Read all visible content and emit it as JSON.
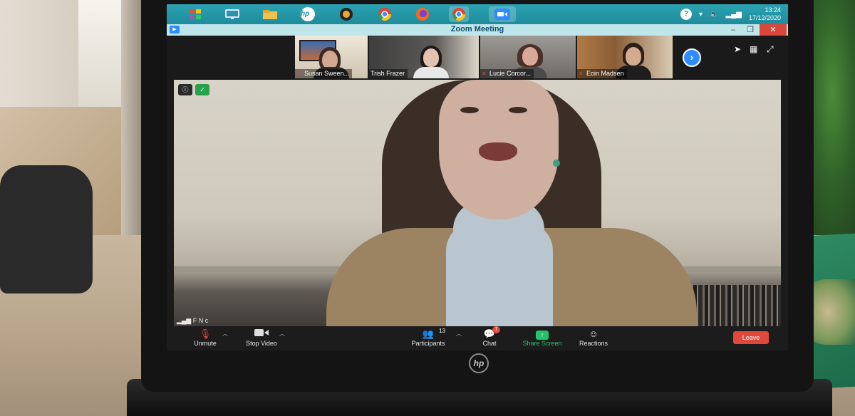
{
  "taskbar": {
    "icons": [
      "app-grid-icon",
      "display-icon",
      "file-explorer-icon",
      "hp-support-icon",
      "media-icon",
      "chrome-icon",
      "firefox-icon",
      "chrome-alt-icon",
      "zoom-icon"
    ],
    "hp_label": "hp",
    "clock_time": "13:24",
    "clock_date": "17/12/2020"
  },
  "zoom": {
    "window_title": "Zoom Meeting",
    "participants": [
      {
        "name": "Susan Sween..."
      },
      {
        "name": "Trish Frazer"
      },
      {
        "name": "Lucie Corcor..."
      },
      {
        "name": "Eoin Madsen"
      }
    ],
    "active_speaker": {
      "signal_label": "F N c"
    },
    "controls": {
      "unmute_label": "Unmute",
      "stop_video_label": "Stop Video",
      "participants_label": "Participants",
      "participants_count": "13",
      "chat_label": "Chat",
      "chat_badge": "1",
      "share_label": "Share Screen",
      "reactions_label": "Reactions",
      "leave_label": "Leave"
    }
  },
  "laptop": {
    "logo_text": "hp"
  },
  "colors": {
    "taskbar": "#2aa3b2",
    "zoom_blue": "#2d8cff",
    "share_green": "#26c26b",
    "leave_red": "#e0483c"
  }
}
